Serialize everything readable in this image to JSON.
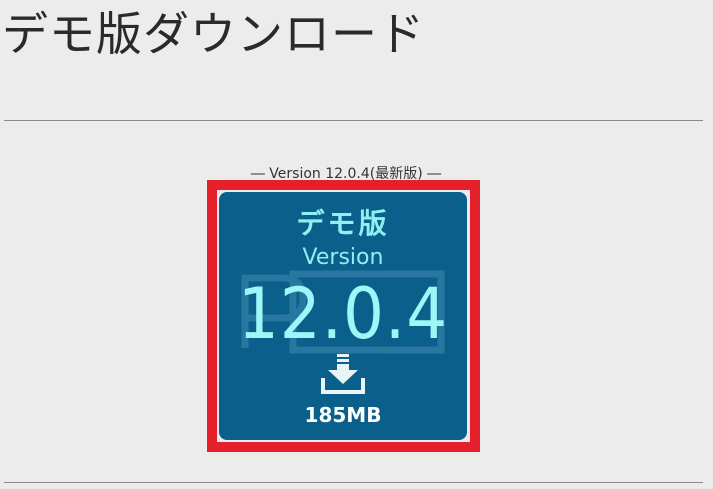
{
  "page": {
    "title": "デモ版ダウンロード"
  },
  "download": {
    "caption": "― Version 12.0.4(最新版) ―",
    "card": {
      "badge": "デモ版",
      "version_word": "Version",
      "version_number": "12.0.4",
      "file_size": "185MB",
      "icon": "download-icon"
    }
  },
  "colors": {
    "background": "#ececec",
    "card": "#0b5f8b",
    "card_text": "#8ff0f2",
    "highlight": "#e6202a"
  }
}
